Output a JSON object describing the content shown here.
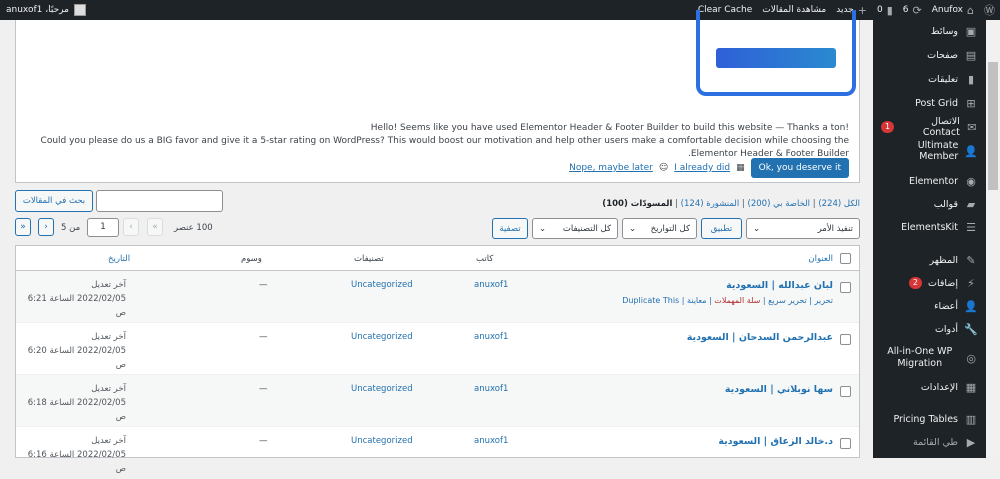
{
  "adminbar": {
    "site": "Anufox",
    "updates": "6",
    "comments": "0",
    "new": "جديد",
    "view_posts": "مشاهدة المقالات",
    "clear_cache": "Clear Cache",
    "greeting": "مرحبًا، anuxof1"
  },
  "sidebar": {
    "items": [
      {
        "label": "وسائط",
        "icon": "media-icon"
      },
      {
        "label": "صفحات",
        "icon": "pages-icon"
      },
      {
        "label": "تعليقات",
        "icon": "comments-icon"
      },
      {
        "label": "Post Grid",
        "icon": "grid-icon"
      },
      {
        "label": "الاتصال Contact",
        "icon": "mail-icon",
        "badge": "1"
      },
      {
        "label": "Ultimate Member",
        "icon": "user-icon"
      },
      {
        "label": "Elementor",
        "icon": "elementor-icon"
      },
      {
        "label": "قوالب",
        "icon": "folder-icon"
      },
      {
        "label": "ElementsKit",
        "icon": "elementskit-icon"
      },
      {
        "label": "المظهر",
        "icon": "brush-icon"
      },
      {
        "label": "إضافات",
        "icon": "plugin-icon",
        "badge": "2"
      },
      {
        "label": "أعضاء",
        "icon": "user-icon"
      },
      {
        "label": "أدوات",
        "icon": "wrench-icon"
      },
      {
        "label": "All-in-One WP Migration",
        "icon": "migration-icon"
      },
      {
        "label": "الإعدادات",
        "icon": "settings-icon"
      },
      {
        "label": "Pricing Tables",
        "icon": "chart-icon"
      },
      {
        "label": "طي القائمة",
        "icon": "collapse-icon"
      }
    ]
  },
  "notice": {
    "line1": "!Hello! Seems like you have used Elementor Header & Footer Builder to build this website — Thanks a ton",
    "line2": "Could you please do us a BIG favor and give it a 5-star rating on WordPress? This would boost our motivation and help other users make a comfortable decision while choosing the Elementor Header & Footer Builder.",
    "ok": "Ok, you deserve it",
    "already": "I already did",
    "later": "Nope, maybe later"
  },
  "filters": {
    "all": "الكل (224)",
    "mine": "الخاصة بي (200)",
    "published": "المنشورة (124)",
    "drafts": "المسودّات (100)",
    "search_btn": "بحث في المقالات",
    "search_value": "",
    "bulk": "تنفيذ الأمر",
    "apply": "تطبيق",
    "dates": "كل التواريخ",
    "cats": "كل التصنيفات",
    "filter": "تصفية",
    "count": "100 عنصر",
    "page": "1",
    "of": "من 5"
  },
  "table": {
    "headers": {
      "title": "العنوان",
      "author": "كاتب",
      "cats": "تصنيفات",
      "tags": "وسوم",
      "date": "التاريخ"
    },
    "row_actions": {
      "edit": "تحرير",
      "quick": "تحرير سريع",
      "trash": "سلة المهملات",
      "view": "معاينة",
      "dup": "Duplicate This"
    },
    "rows": [
      {
        "title": "لبان عبدالله | السعودية",
        "author": "anuxof1",
        "cat": "Uncategorized",
        "tags": "—",
        "status": "آخر تعديل",
        "date": "2022/02/05 الساعة 6:21",
        "ampm": "ص"
      },
      {
        "title": "عبدالرحمن السدحان | السعودية",
        "author": "anuxof1",
        "cat": "Uncategorized",
        "tags": "—",
        "status": "آخر تعديل",
        "date": "2022/02/05 الساعة 6:20",
        "ampm": "ص"
      },
      {
        "title": "سها نوبلاني | السعودية",
        "author": "anuxof1",
        "cat": "Uncategorized",
        "tags": "—",
        "status": "آخر تعديل",
        "date": "2022/02/05 الساعة 6:18",
        "ampm": "ص"
      },
      {
        "title": "د.خالد الزعاق | السعودية",
        "author": "anuxof1",
        "cat": "Uncategorized",
        "tags": "—",
        "status": "آخر تعديل",
        "date": "2022/02/05 الساعة 6:16",
        "ampm": "ص"
      }
    ]
  }
}
